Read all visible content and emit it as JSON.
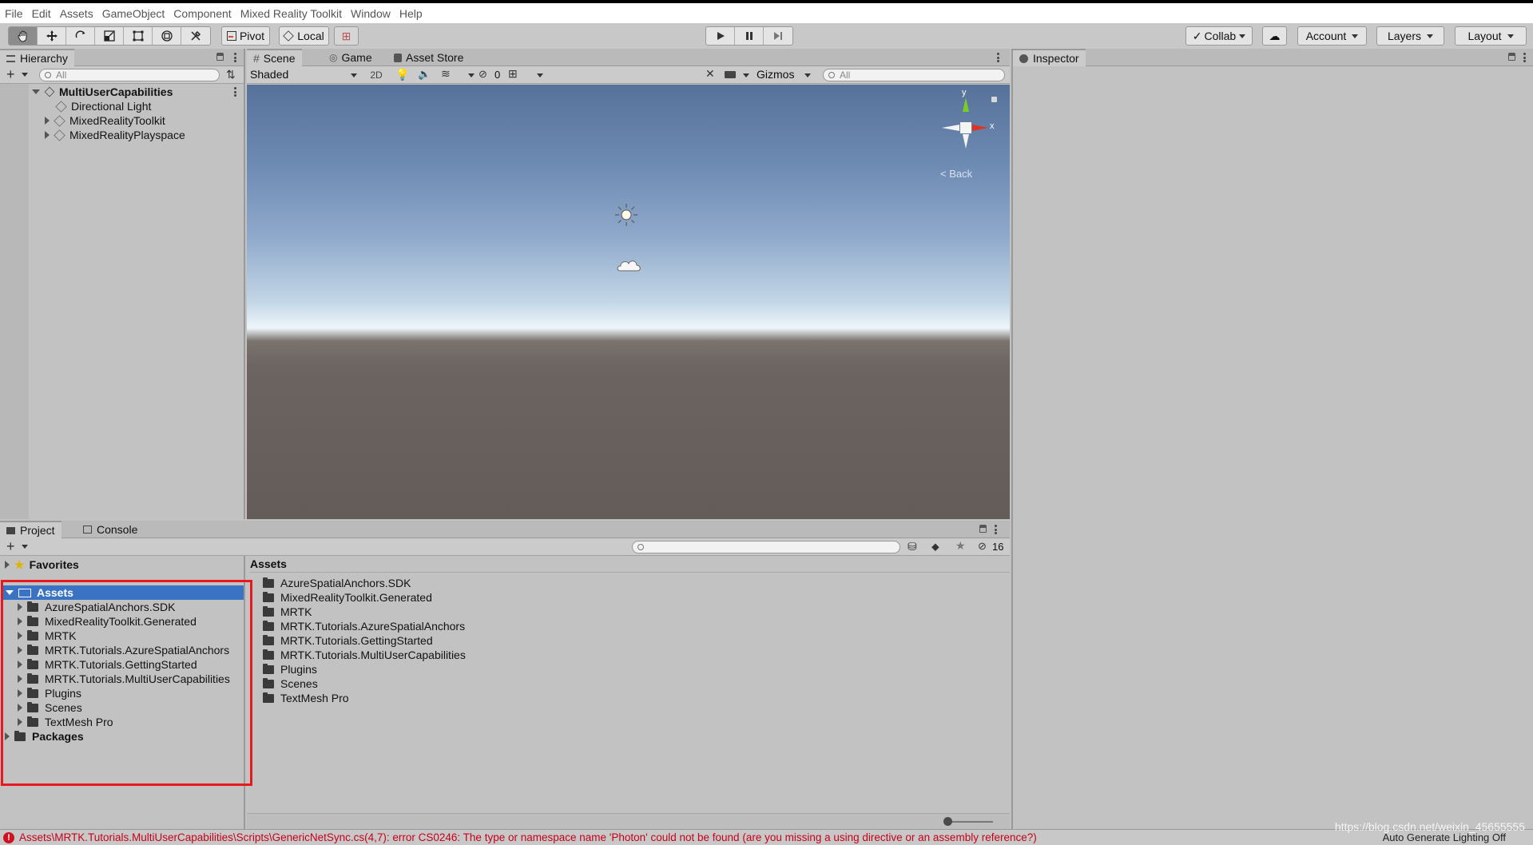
{
  "menu": [
    "File",
    "Edit",
    "Assets",
    "GameObject",
    "Component",
    "Mixed Reality Toolkit",
    "Window",
    "Help"
  ],
  "toolbar": {
    "pivot_label": "Pivot",
    "local_label": "Local",
    "collab_label": "Collab",
    "account_label": "Account",
    "layers_label": "Layers",
    "layout_label": "Layout"
  },
  "hierarchy": {
    "tab_label": "Hierarchy",
    "search_placeholder": "All",
    "scene_name": "MultiUserCapabilities",
    "items": [
      "Directional Light",
      "MixedRealityToolkit",
      "MixedRealityPlayspace"
    ]
  },
  "scene_view": {
    "tabs": [
      "Scene",
      "Game",
      "Asset Store"
    ],
    "shading_mode": "Shaded",
    "mode_2d": "2D",
    "hidden_count": "0",
    "gizmos_label": "Gizmos",
    "search_placeholder": "All",
    "gizmo_axes": {
      "y": "y",
      "x": "x"
    },
    "view_label": "Back"
  },
  "inspector": {
    "tab_label": "Inspector"
  },
  "project": {
    "tabs": [
      "Project",
      "Console"
    ],
    "favorites_label": "Favorites",
    "assets_label": "Assets",
    "packages_label": "Packages",
    "hidden_count": "16",
    "breadcrumb": "Assets",
    "folders": [
      "AzureSpatialAnchors.SDK",
      "MixedRealityToolkit.Generated",
      "MRTK",
      "MRTK.Tutorials.AzureSpatialAnchors",
      "MRTK.Tutorials.GettingStarted",
      "MRTK.Tutorials.MultiUserCapabilities",
      "Plugins",
      "Scenes",
      "TextMesh Pro"
    ]
  },
  "status": {
    "error_message": "Assets\\MRTK.Tutorials.MultiUserCapabilities\\Scripts\\GenericNetSync.cs(4,7): error CS0246: The type or namespace name 'Photon' could not be found (are you missing a using directive or an assembly reference?)",
    "right_text": "Auto Generate Lighting Off",
    "watermark": "https://blog.csdn.net/weixin_45655555"
  },
  "colors": {
    "accent_selection": "#3a72c4",
    "highlight_box": "#e8181e",
    "error_text": "#c8001a",
    "gizmo_y": "#7acc29",
    "gizmo_x": "#e1331d"
  }
}
